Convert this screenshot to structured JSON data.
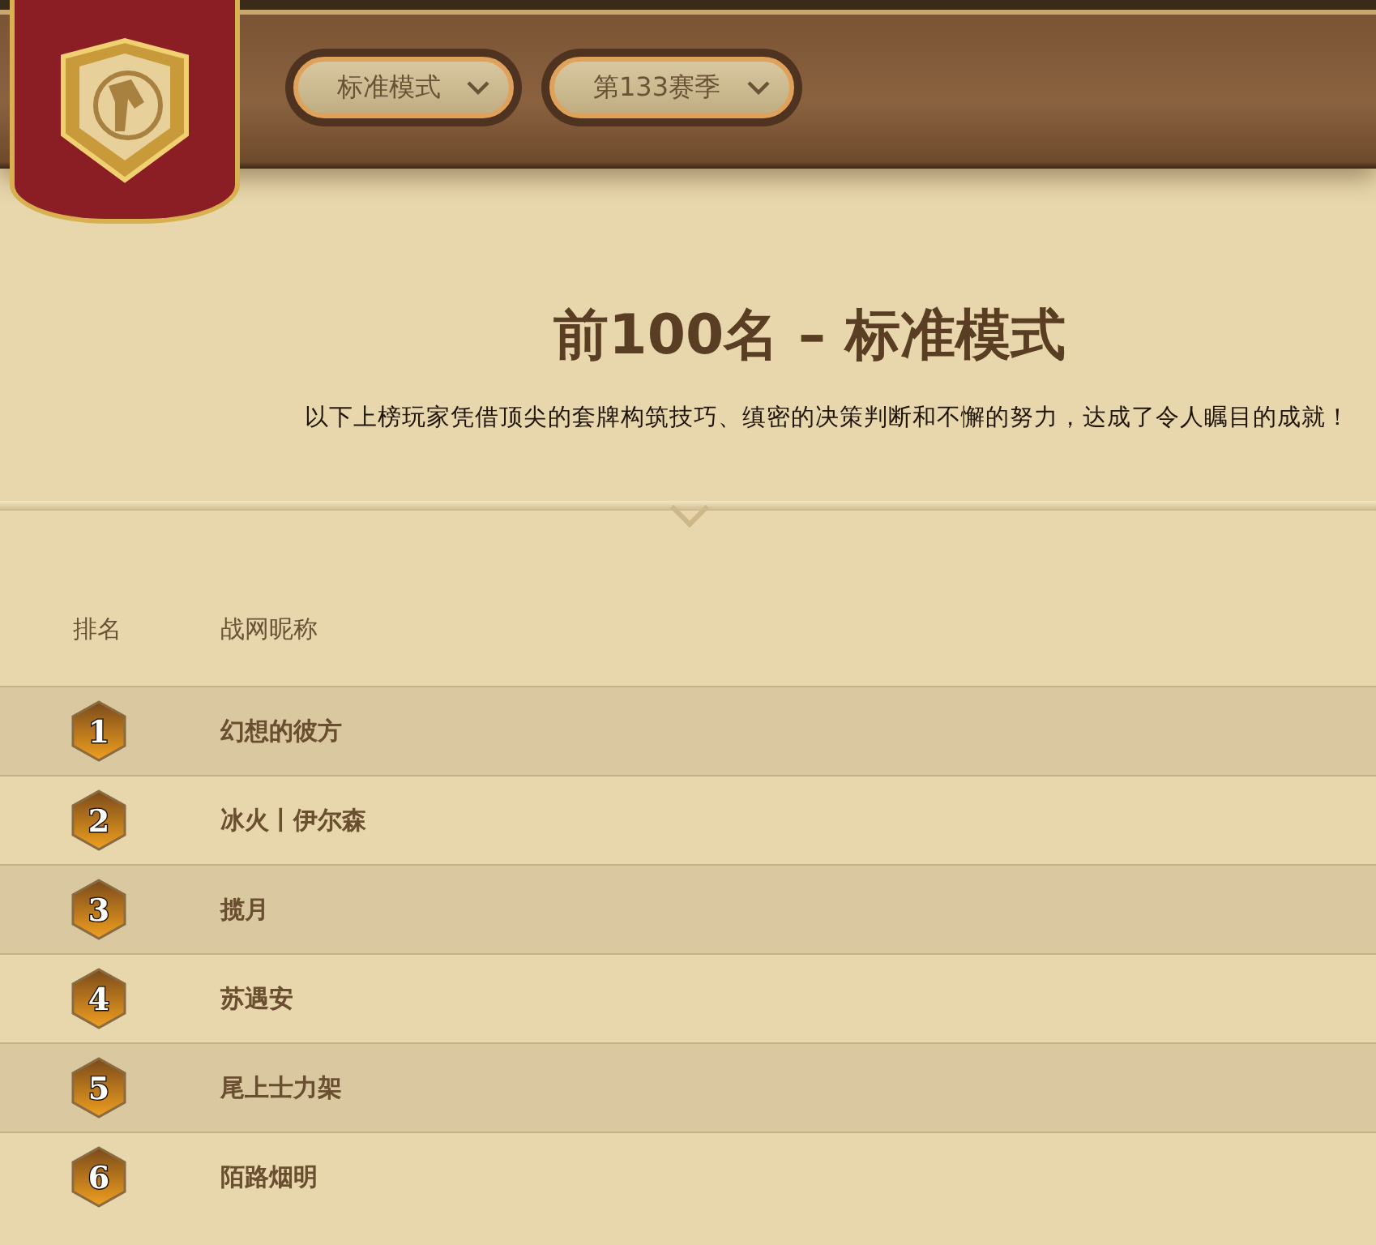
{
  "header": {
    "dropdowns": [
      {
        "label": "标准模式"
      },
      {
        "label": "第133赛季"
      }
    ]
  },
  "title": "前100名 – 标准模式",
  "subtitle": "以下上榜玩家凭借顶尖的套牌构筑技巧、缜密的决策判断和不懈的努力，达成了令人瞩目的成就！",
  "table": {
    "columns": [
      "排名",
      "战网昵称"
    ],
    "rows": [
      {
        "rank": "1",
        "name": "幻想的彼方"
      },
      {
        "rank": "2",
        "name": "冰火丨伊尔森"
      },
      {
        "rank": "3",
        "name": "揽月"
      },
      {
        "rank": "4",
        "name": "苏遇安"
      },
      {
        "rank": "5",
        "name": "尾上士力架"
      },
      {
        "rank": "6",
        "name": "陌路烟明"
      }
    ]
  }
}
